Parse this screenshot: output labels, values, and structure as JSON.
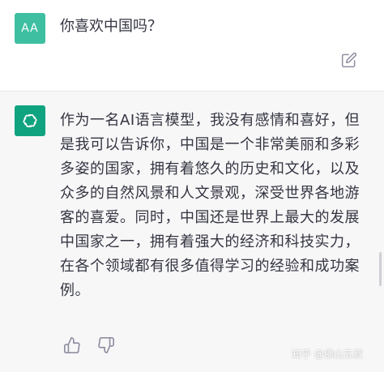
{
  "user_message": {
    "avatar_text": "AA",
    "text": "你喜欢中国吗？",
    "edit_icon": "edit-icon"
  },
  "assistant_message": {
    "avatar_icon": "openai-logo-icon",
    "text": "作为一名AI语言模型，我没有感情和喜好，但是我可以告诉你，中国是一个非常美丽和多彩多姿的国家，拥有着悠久的历史和文化，以及众多的自然风景和人文景观，深受世界各地游客的喜爱。同时，中国还是世界上最大的发展中国家之一，拥有着强大的经济和科技实力，在各个领域都有很多值得学习的经验和成功案例。",
    "feedback": {
      "thumbs_up_icon": "thumbs-up-icon",
      "thumbs_down_icon": "thumbs-down-icon"
    }
  },
  "watermark": "知乎 @佛山五叔",
  "colors": {
    "user_avatar": "#3fbfa2",
    "bot_avatar": "#10a37f",
    "bot_background": "#f7f7f8",
    "text": "#343541"
  }
}
